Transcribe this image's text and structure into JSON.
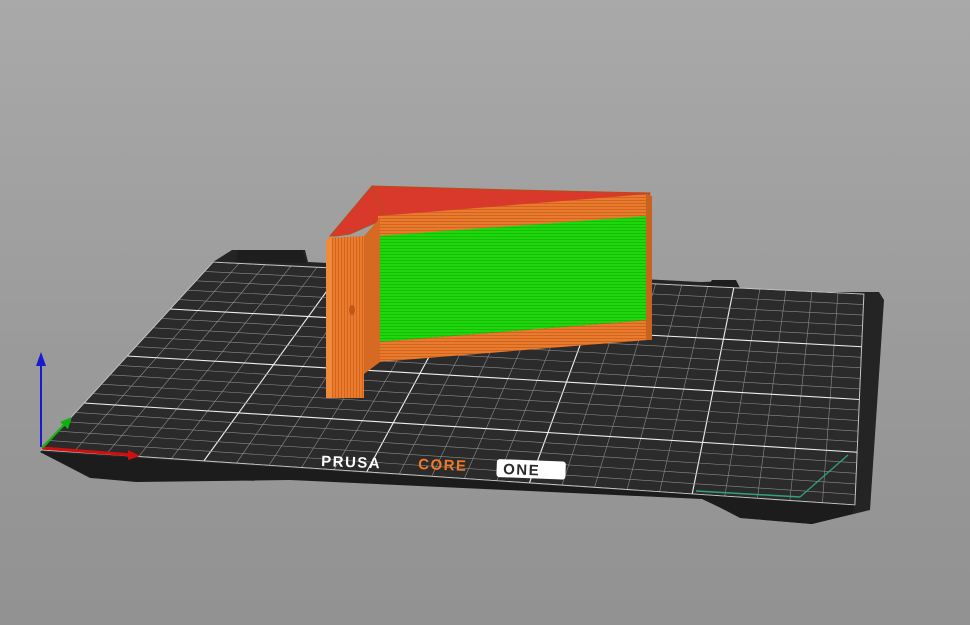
{
  "bed": {
    "brand": {
      "word1": "PRUSA",
      "word2": "CORE",
      "word3": "ONE"
    },
    "colors": {
      "sheet": "#2a2a2a",
      "grid_minor": "#8f8f8f",
      "grid_major": "#f2f2f2",
      "brand_white": "#ffffff",
      "brand_orange": "#f07a2a"
    }
  },
  "model": {
    "colors": {
      "perimeter": "#e8782a",
      "solid_infill": "#22dd00",
      "top_surface": "#d93a2a"
    }
  },
  "axes": {
    "colors": {
      "x": "#d01010",
      "y": "#10b010",
      "z": "#1010d0"
    }
  }
}
